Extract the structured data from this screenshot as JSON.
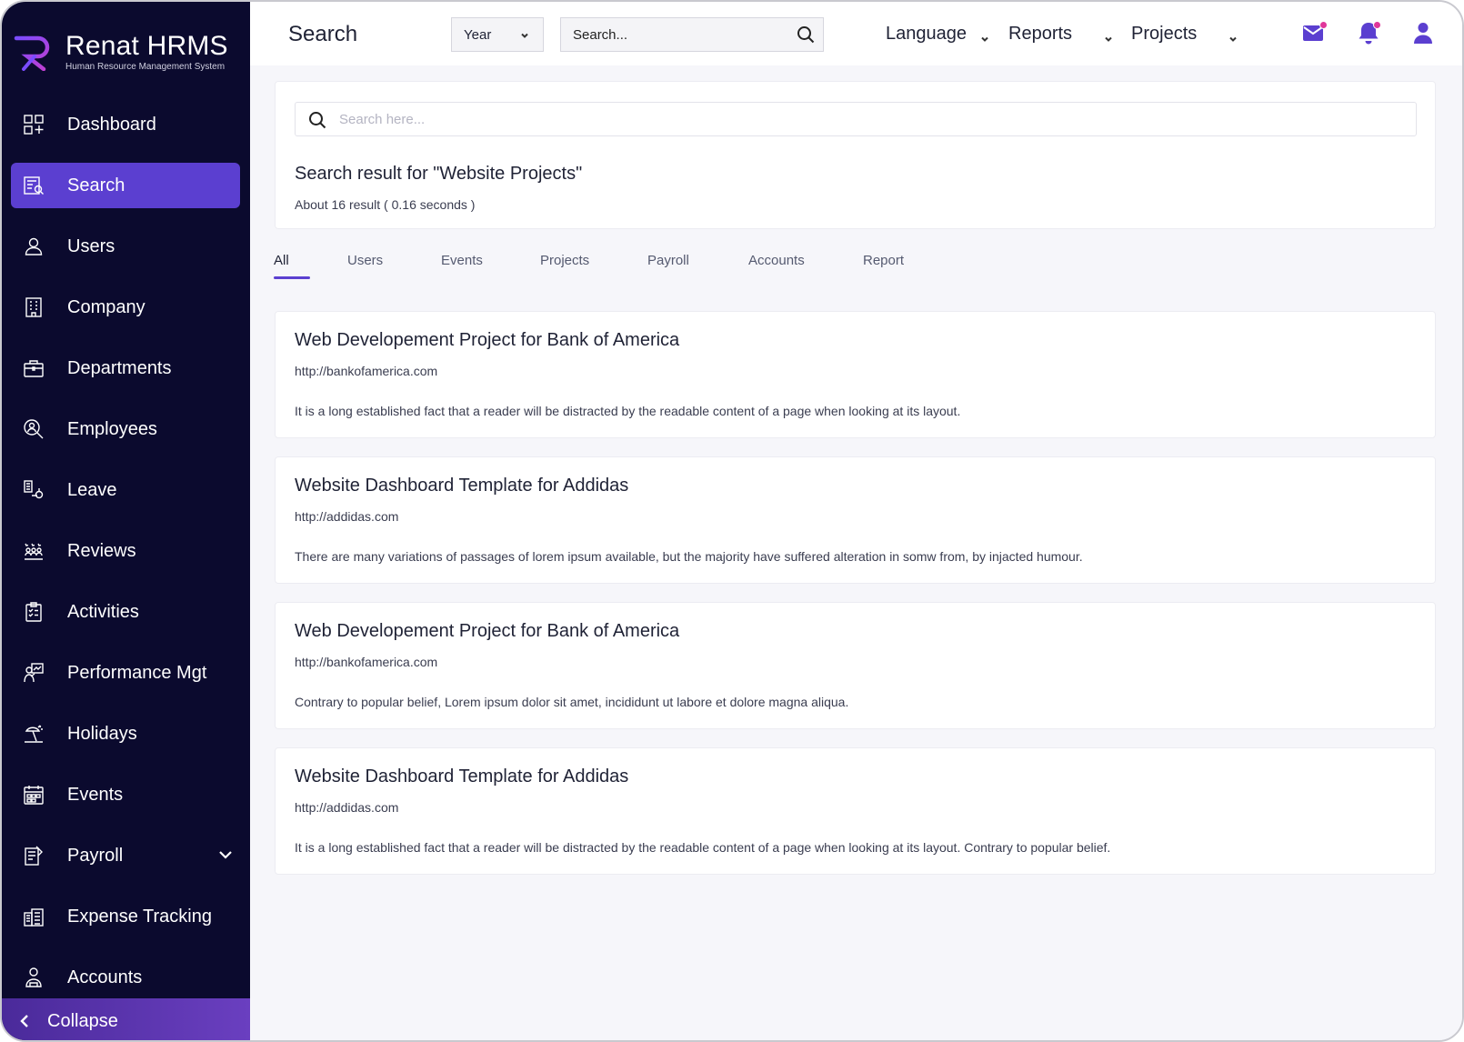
{
  "app": {
    "logo_title": "Renat HRMS",
    "logo_subtitle": "Human Resource Management System"
  },
  "sidebar": {
    "items": [
      {
        "label": "Dashboard",
        "icon": "dashboard-icon"
      },
      {
        "label": "Search",
        "icon": "search-document-icon",
        "active": true
      },
      {
        "label": "Users",
        "icon": "user-icon"
      },
      {
        "label": "Company",
        "icon": "building-icon"
      },
      {
        "label": "Departments",
        "icon": "briefcase-icon"
      },
      {
        "label": "Employees",
        "icon": "employee-search-icon"
      },
      {
        "label": "Leave",
        "icon": "leave-icon"
      },
      {
        "label": "Reviews",
        "icon": "reviews-icon"
      },
      {
        "label": "Activities",
        "icon": "clipboard-icon"
      },
      {
        "label": "Performance Mgt",
        "icon": "performance-icon"
      },
      {
        "label": "Holidays",
        "icon": "beach-icon"
      },
      {
        "label": "Events",
        "icon": "calendar-icon"
      },
      {
        "label": "Payroll",
        "icon": "payroll-icon",
        "has_submenu": true
      },
      {
        "label": "Expense Tracking",
        "icon": "expense-icon"
      },
      {
        "label": "Accounts",
        "icon": "accounts-icon"
      }
    ],
    "collapse_label": "Collapse"
  },
  "topbar": {
    "title": "Search",
    "year_select": "Year",
    "search_placeholder": "Search...",
    "menus": [
      "Language",
      "Reports",
      "Projects"
    ]
  },
  "search_panel": {
    "placeholder": "Search here...",
    "heading": "Search result for \"Website Projects\"",
    "meta": "About 16 result ( 0.16 seconds )"
  },
  "tabs": [
    "All",
    "Users",
    "Events",
    "Projects",
    "Payroll",
    "Accounts",
    "Report"
  ],
  "results": [
    {
      "title": "Web Developement Project for Bank of America",
      "url": "http://bankofamerica.com",
      "description": "It is a long established fact that a reader will be distracted by the readable content of a page when looking at its layout."
    },
    {
      "title": "Website Dashboard Template for Addidas",
      "url": "http://addidas.com",
      "description": "There are many variations of passages of lorem ipsum available, but the majority have suffered alteration in somw from, by injacted humour."
    },
    {
      "title": "Web Developement Project for Bank of America",
      "url": "http://bankofamerica.com",
      "description": "Contrary to popular belief, Lorem ipsum dolor sit amet, incididunt ut labore et dolore magna aliqua."
    },
    {
      "title": "Website Dashboard Template for Addidas",
      "url": "http://addidas.com",
      "description": "It is a long established fact that a reader will be distracted by the readable content of a page when looking at its layout. Contrary to popular belief."
    }
  ],
  "colors": {
    "sidebar_bg": "#0b0a2e",
    "accent": "#5b3fd0",
    "notification_dot": "#e0369a"
  }
}
